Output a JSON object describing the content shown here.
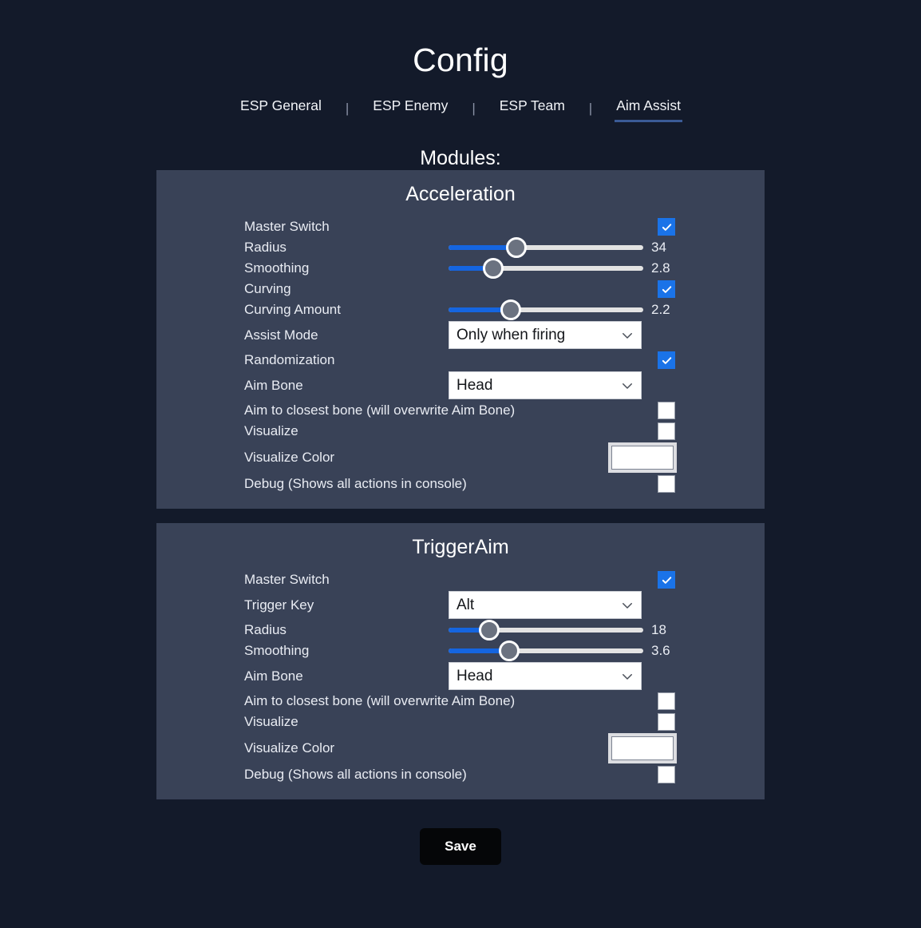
{
  "header": {
    "title": "Config",
    "tabs": [
      {
        "label": "ESP General",
        "active": false
      },
      {
        "label": "ESP Enemy",
        "active": false
      },
      {
        "label": "ESP Team",
        "active": false
      },
      {
        "label": "Aim Assist",
        "active": true
      }
    ],
    "separator": "|",
    "modules_label": "Modules:"
  },
  "colors": {
    "page_background": "#131a2a",
    "panel_background": "#394257",
    "accent_blue": "#1a73e8",
    "slider_fill": "#1565e0",
    "slider_track": "#e3e3e3",
    "slider_thumb": "#6b7280",
    "tab_underline": "#3b5b96",
    "text": "#e9ecf3",
    "save_button_background": "#050608"
  },
  "modules": [
    {
      "name": "Acceleration",
      "rows": [
        {
          "type": "checkbox",
          "label": "Master Switch",
          "checked": true
        },
        {
          "type": "slider",
          "label": "Radius",
          "value": "34",
          "percent": 35
        },
        {
          "type": "slider",
          "label": "Smoothing",
          "value": "2.8",
          "percent": 23
        },
        {
          "type": "checkbox",
          "label": "Curving",
          "checked": true
        },
        {
          "type": "slider",
          "label": "Curving Amount",
          "value": "2.2",
          "percent": 32
        },
        {
          "type": "select",
          "label": "Assist Mode",
          "value": "Only when firing"
        },
        {
          "type": "checkbox",
          "label": "Randomization",
          "checked": true
        },
        {
          "type": "select",
          "label": "Aim Bone",
          "value": "Head"
        },
        {
          "type": "checkbox",
          "label": "Aim to closest bone (will overwrite Aim Bone)",
          "checked": false
        },
        {
          "type": "checkbox",
          "label": "Visualize",
          "checked": false
        },
        {
          "type": "color",
          "label": "Visualize Color",
          "value": "#ffffff"
        },
        {
          "type": "checkbox",
          "label": "Debug (Shows all actions in console)",
          "checked": false
        }
      ]
    },
    {
      "name": "TriggerAim",
      "rows": [
        {
          "type": "checkbox",
          "label": "Master Switch",
          "checked": true
        },
        {
          "type": "select",
          "label": "Trigger Key",
          "value": "Alt"
        },
        {
          "type": "slider",
          "label": "Radius",
          "value": "18",
          "percent": 21
        },
        {
          "type": "slider",
          "label": "Smoothing",
          "value": "3.6",
          "percent": 31
        },
        {
          "type": "select",
          "label": "Aim Bone",
          "value": "Head"
        },
        {
          "type": "checkbox",
          "label": "Aim to closest bone (will overwrite Aim Bone)",
          "checked": false
        },
        {
          "type": "checkbox",
          "label": "Visualize",
          "checked": false
        },
        {
          "type": "color",
          "label": "Visualize Color",
          "value": "#ffffff"
        },
        {
          "type": "checkbox",
          "label": "Debug (Shows all actions in console)",
          "checked": false
        }
      ]
    }
  ],
  "footer": {
    "save_label": "Save"
  }
}
